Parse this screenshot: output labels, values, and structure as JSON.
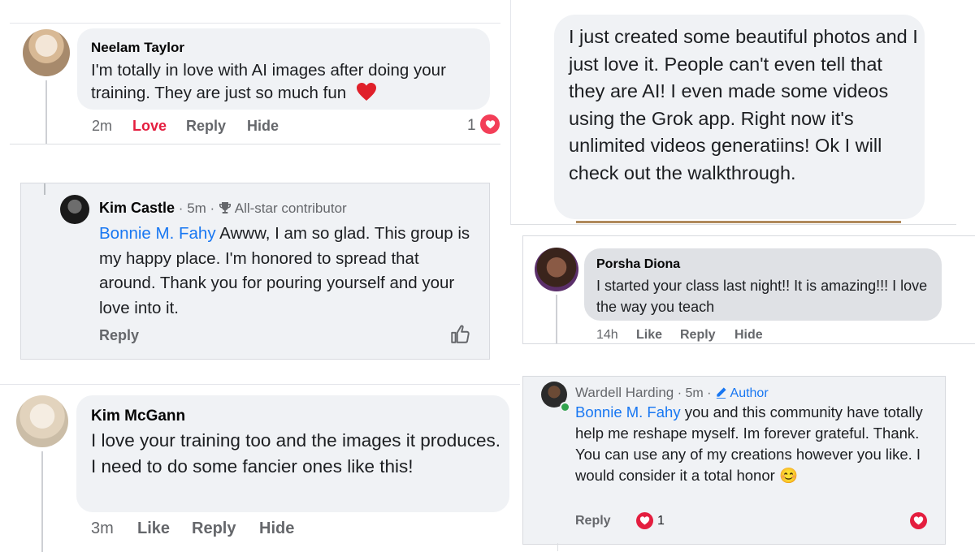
{
  "c1": {
    "name": "Neelam Taylor",
    "text": "I'm totally in love with AI images after doing your training. They are just so much fun",
    "time": "2m",
    "love": "Love",
    "reply": "Reply",
    "hide": "Hide",
    "count": "1"
  },
  "c2": {
    "name": "Kim Castle",
    "sep1": "·",
    "time": "5m",
    "sep2": "·",
    "badge": "All-star contributor",
    "mention": "Bonnie M. Fahy",
    "text": "Awww, I am so glad. This group is my happy place. I'm honored to spread that around. Thank you for pouring yourself and your love into it.",
    "reply": "Reply"
  },
  "c3": {
    "name": "Kim McGann",
    "text": "I love your training too and the images it produces. I need to do some fancier ones like this!",
    "time": "3m",
    "like": "Like",
    "reply": "Reply",
    "hide": "Hide"
  },
  "c4": {
    "text": "I just created some beautiful photos and I just love it. People can't even tell that they are AI!  I even made some videos using the Grok app. Right now it's unlimited videos generatiins!  Ok I will check out the walkthrough."
  },
  "c5": {
    "name": "Porsha Diona",
    "text": "I started your class last night!! It is amazing!!! I love the way you teach",
    "time": "14h",
    "like": "Like",
    "reply": "Reply",
    "hide": "Hide"
  },
  "c6": {
    "name": "Wardell Harding",
    "sep1": "·",
    "time": "5m",
    "sep2": "·",
    "badge": "Author",
    "mention": "Bonnie M. Fahy",
    "text": "you and this community have totally help me reshape myself. Im forever grateful. Thank. You can use any of my creations however you like. I would consider it a total honor",
    "emoji": "😊",
    "reply": "Reply",
    "count": "1"
  },
  "colors": {
    "love": "#e41e3f",
    "mention": "#1877f2",
    "bubble": "#f0f2f5",
    "meta": "#65676b",
    "online": "#31a24c"
  }
}
